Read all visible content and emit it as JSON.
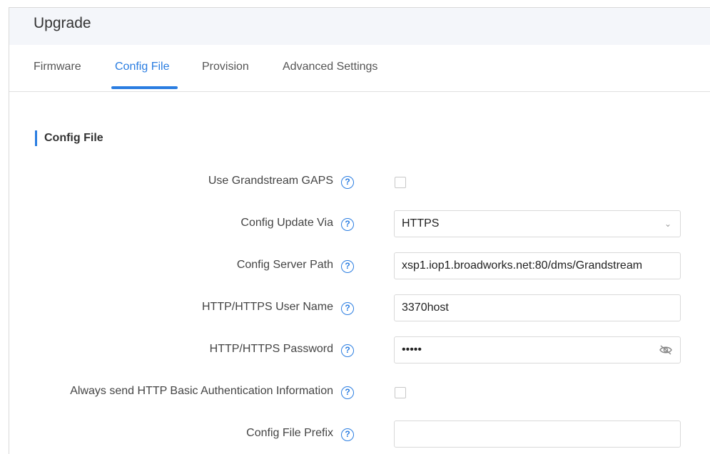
{
  "header": {
    "title": "Upgrade"
  },
  "tabs": [
    {
      "label": "Firmware",
      "active": false
    },
    {
      "label": "Config File",
      "active": true
    },
    {
      "label": "Provision",
      "active": false
    },
    {
      "label": "Advanced Settings",
      "active": false
    }
  ],
  "section": {
    "title": "Config File"
  },
  "form": {
    "use_gaps": {
      "label": "Use Grandstream GAPS",
      "checked": false
    },
    "update_via": {
      "label": "Config Update Via",
      "value": "HTTPS"
    },
    "server_path": {
      "label": "Config Server Path",
      "value": "xsp1.iop1.broadworks.net:80/dms/Grandstream"
    },
    "user_name": {
      "label": "HTTP/HTTPS User Name",
      "value": "3370host"
    },
    "password": {
      "label": "HTTP/HTTPS Password",
      "value": "•••••"
    },
    "basic_auth": {
      "label": "Always send HTTP Basic Authentication Information",
      "checked": false
    },
    "file_prefix": {
      "label": "Config File Prefix",
      "value": ""
    }
  },
  "colors": {
    "accent": "#2a7de1",
    "header_bg": "#f4f6fa"
  },
  "icons": {
    "help": "question-circle-icon",
    "chevron": "chevron-down-icon",
    "eye": "eye-slash-icon"
  }
}
